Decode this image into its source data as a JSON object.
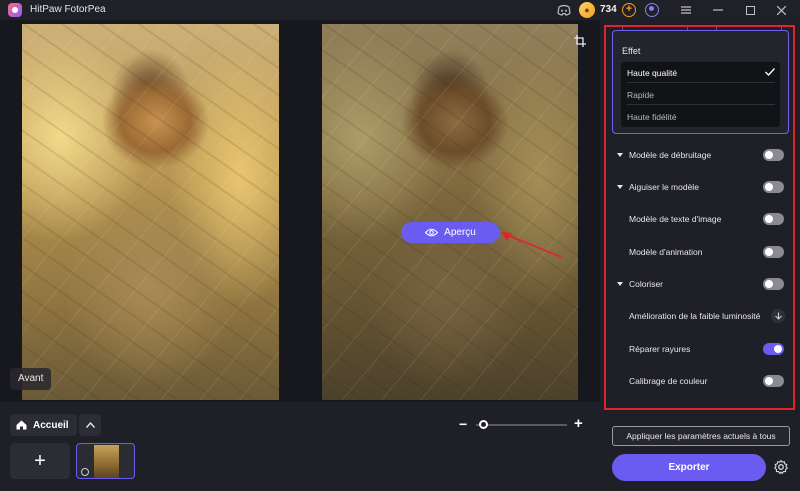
{
  "app": {
    "title": "HitPaw FotorPea",
    "credits": "734"
  },
  "canvas": {
    "before_label": "Avant",
    "preview_label": "Aperçu"
  },
  "bottom": {
    "home_label": "Accueil",
    "add_label": "+"
  },
  "effect": {
    "label": "Effet",
    "options": [
      "Haute qualité",
      "Rapide",
      "Haute fidélité"
    ],
    "selected": "Haute qualité"
  },
  "settings": [
    {
      "label": "Modèle de débruitage",
      "expandable": true,
      "control": "toggle",
      "on": false
    },
    {
      "label": "Aiguiser le modèle",
      "expandable": true,
      "control": "toggle",
      "on": false
    },
    {
      "label": "Modèle de texte d'image",
      "expandable": false,
      "control": "toggle",
      "on": false
    },
    {
      "label": "Modèle d'animation",
      "expandable": false,
      "control": "toggle",
      "on": false
    },
    {
      "label": "Coloriser",
      "expandable": true,
      "control": "toggle",
      "on": false
    },
    {
      "label": "Amélioration de la faible luminosité",
      "expandable": false,
      "control": "download"
    },
    {
      "label": "Réparer rayures",
      "expandable": false,
      "control": "toggle",
      "on": true
    },
    {
      "label": "Calibrage de couleur",
      "expandable": false,
      "control": "toggle",
      "on": false
    }
  ],
  "actions": {
    "apply_label": "Appliquer les paramètres actuels à tous",
    "export_label": "Exporter"
  },
  "colors": {
    "accent": "#6a5cf0",
    "highlight_frame": "#e0242b",
    "background": "#1b1c22"
  }
}
